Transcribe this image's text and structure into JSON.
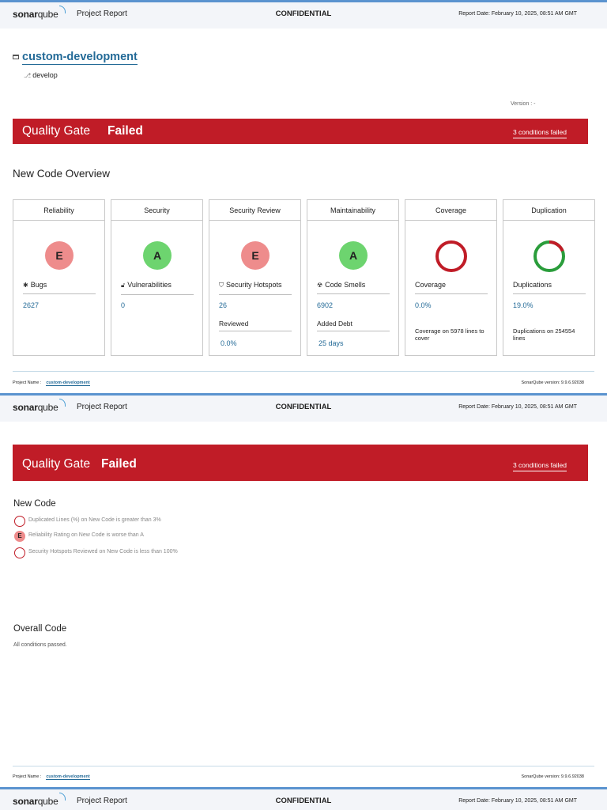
{
  "header": {
    "logo_bold": "sonar",
    "logo_light": "qube",
    "title": "Project Report",
    "confidential": "CONFIDENTIAL",
    "report_date": "Report Date: February 10, 2025, 08:51 AM GMT"
  },
  "project": {
    "name": "custom-development",
    "branch": "develop",
    "version": "Version : -"
  },
  "quality_gate": {
    "label": "Quality Gate",
    "status": "Failed",
    "conditions_failed": "3 conditions failed"
  },
  "overview_title": "New Code Overview",
  "cards": [
    {
      "title": "Reliability",
      "rating": "E",
      "metric": "Bugs",
      "value": "2627",
      "icon": "bug-icon"
    },
    {
      "title": "Security",
      "rating": "A",
      "metric": "Vulnerabilities",
      "value": "0",
      "icon": "lock-icon"
    },
    {
      "title": "Security Review",
      "rating": "E",
      "metric": "Security Hotspots",
      "value": "26",
      "sub_label": "Reviewed",
      "sub_value": "0.0%",
      "icon": "shield-icon"
    },
    {
      "title": "Maintainability",
      "rating": "A",
      "metric": "Code Smells",
      "value": "6902",
      "sub_label": "Added Debt",
      "sub_value": "25 days",
      "icon": "smell-icon"
    },
    {
      "title": "Coverage",
      "metric": "Coverage",
      "value": "0.0%",
      "note": "Coverage on 5978 lines to cover",
      "coverage_fraction": 0.0
    },
    {
      "title": "Duplication",
      "metric": "Duplications",
      "value": "19.0%",
      "note": "Duplications on 254554 lines",
      "duplication_fraction": 0.19
    }
  ],
  "footer": {
    "project_label": "Project Name :",
    "project_link": "custom-development",
    "version": "SonarQube version: 9.9.6.92038"
  },
  "page2": {
    "new_code_title": "New Code",
    "conditions": [
      {
        "text": "Duplicated Lines (%) on New Code is greater than 3%",
        "mark": "ring"
      },
      {
        "text": "Reliability Rating on New Code is worse than A",
        "mark": "E"
      },
      {
        "text": "Security Hotspots Reviewed on New Code is less than 100%",
        "mark": "ring"
      }
    ],
    "overall_title": "Overall Code",
    "overall_text": "All conditions passed."
  },
  "colors": {
    "failed_red": "#c01c27",
    "rating_e": "#ee8c8c",
    "rating_a": "#6dd46f",
    "link_blue": "#236a97",
    "dup_green": "#2a9d3b"
  }
}
